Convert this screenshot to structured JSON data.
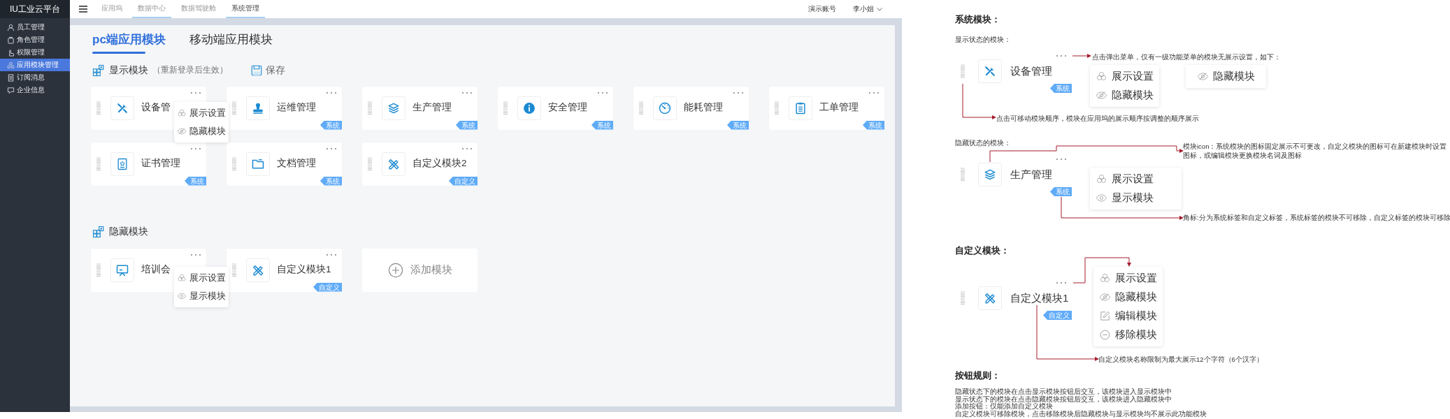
{
  "sidebar": {
    "brand": "IU工业云平台",
    "items": [
      {
        "label": "员工管理",
        "selected": false
      },
      {
        "label": "角色管理",
        "selected": false
      },
      {
        "label": "权限管理",
        "selected": false
      },
      {
        "label": "应用模块管理",
        "selected": true
      },
      {
        "label": "订阅消息",
        "selected": false
      },
      {
        "label": "企业信息",
        "selected": false
      }
    ]
  },
  "top_nav": {
    "tabs": [
      {
        "label": "应用坞",
        "selected": false,
        "hovered": false
      },
      {
        "label": "数据中心",
        "selected": false,
        "hovered": true
      },
      {
        "label": "数据驾驶舱",
        "selected": false,
        "hovered": false
      },
      {
        "label": "系统管理",
        "selected": true,
        "hovered": false
      }
    ],
    "account": "演示账号",
    "user": "李小姐"
  },
  "module_tabs": [
    {
      "label": "pc端应用模块",
      "selected": true
    },
    {
      "label": "移动端应用模块",
      "selected": false
    }
  ],
  "display_section": {
    "title": "显示模块",
    "note": "（重新登录后生效）",
    "save": "保存",
    "modules": [
      {
        "name": "设备管",
        "menu": [
          {
            "label": "展示设置",
            "kind": "settings"
          },
          {
            "label": "隐藏模块",
            "kind": "hide"
          }
        ]
      },
      {
        "name": "运维管理",
        "tag": "系统"
      },
      {
        "name": "生产管理",
        "tag": "系统"
      },
      {
        "name": "安全管理",
        "tag": "系统"
      },
      {
        "name": "能耗管理",
        "tag": "系统"
      },
      {
        "name": "工单管理",
        "tag": "系统"
      },
      {
        "name": "证书管理",
        "tag": "系统"
      },
      {
        "name": "文档管理",
        "tag": "系统"
      },
      {
        "name": "自定义模块2",
        "tag": "自定义"
      }
    ]
  },
  "hidden_section": {
    "title": "隐藏模块",
    "modules": [
      {
        "name": "培训会",
        "menu": [
          {
            "label": "展示设置",
            "kind": "settings"
          },
          {
            "label": "显示模块",
            "kind": "show"
          }
        ]
      },
      {
        "name": "自定义模块1",
        "tag": "自定义"
      }
    ],
    "add_button": "添加模块"
  },
  "spec": {
    "system_heading": "系统模块：",
    "shown_label": "显示状态的模块：",
    "shown_card": {
      "name": "设备管理",
      "tag": "系统"
    },
    "menu_note": "点击弹出菜单，仅有一级功能菜单的模块无展示设置，如下：",
    "shown_menu": [
      {
        "label": "展示设置",
        "kind": "settings"
      },
      {
        "label": "隐藏模块",
        "kind": "hide"
      }
    ],
    "single_menu": [
      {
        "label": "隐藏模块",
        "kind": "hide"
      }
    ],
    "drag_note": "点击可移动模块顺序，模块在应用坞的展示顺序按调整的顺序展示",
    "hidden_label": "隐藏状态的模块：",
    "hidden_card": {
      "name": "生产管理",
      "tag": "系统"
    },
    "icon_note": "模块icon：系统模块的图标固定展示不可更改，自定义模块的图标可在新建模块时设置图标，或编辑模块更换模块名词及图标",
    "hidden_menu": [
      {
        "label": "展示设置",
        "kind": "settings"
      },
      {
        "label": "显示模块",
        "kind": "show"
      }
    ],
    "tag_note": "角标:分为系统标签和自定义标签，系统标签的模块不可移除，自定义标签的模块可移除",
    "custom_heading": "自定义模块：",
    "custom_card": {
      "name": "自定义模块1",
      "tag": "自定义"
    },
    "custom_menu": [
      {
        "label": "展示设置",
        "kind": "settings"
      },
      {
        "label": "隐藏模块",
        "kind": "hide"
      },
      {
        "label": "编辑模块",
        "kind": "edit"
      },
      {
        "label": "移除模块",
        "kind": "remove"
      }
    ],
    "name_note": "自定义模块名称限制为最大展示12个字符（6个汉字）",
    "rules_heading": "按钮规则：",
    "rules": [
      "隐藏状态下的模块在点击显示模块按钮后交互，该模块进入显示模块中",
      "显示状态下的模块在点击隐藏模块按钮后交互，该模块进入隐藏模块中",
      "添加按钮：仅能添加自定义模块",
      "自定义模块可移除模块，点击移除模块后隐藏模块与显示模块均不展示此功能模块"
    ]
  }
}
